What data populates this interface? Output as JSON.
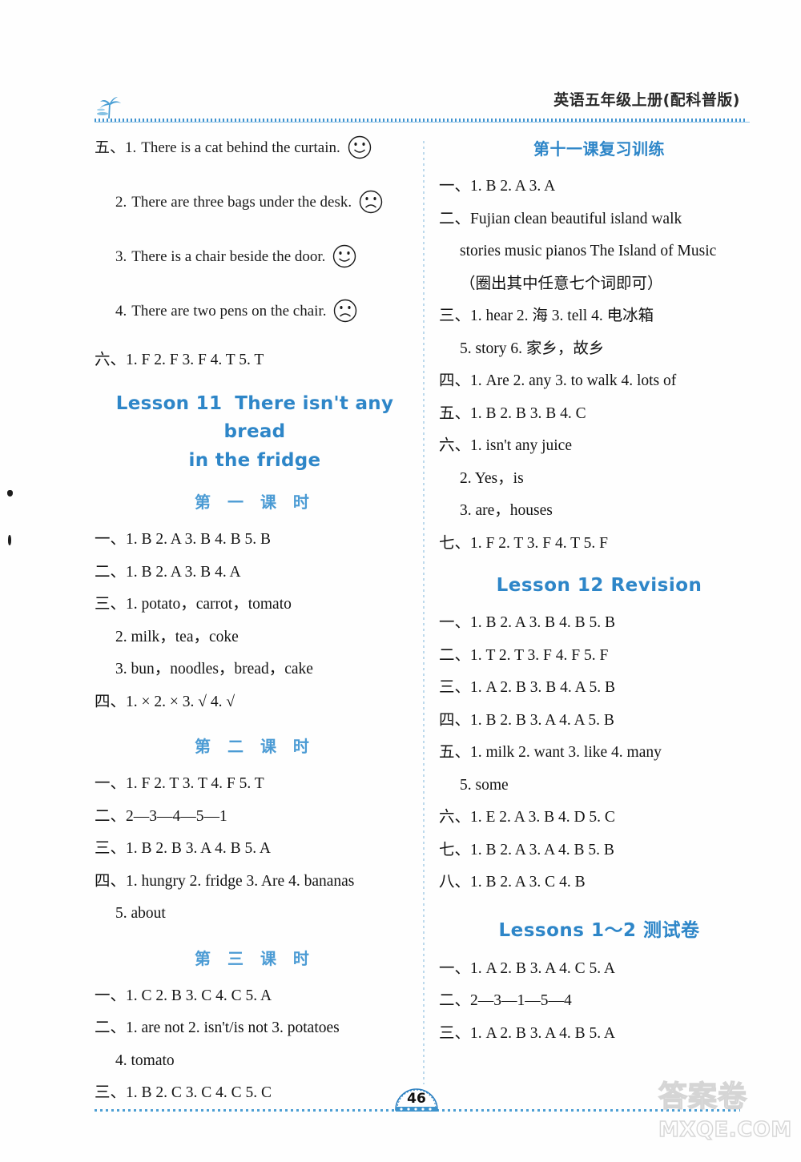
{
  "header": {
    "title": "英语五年级上册(配科普版)",
    "palm_icon": "palm-tree-icon"
  },
  "footer": {
    "page_number": "46",
    "watermark_cn": "答案卷",
    "watermark_url": "MXQE.COM"
  },
  "left_column": {
    "section_five_sentences": [
      {
        "num": "五、1.",
        "text": "There is a cat behind the curtain.",
        "face": "smile"
      },
      {
        "num": "2.",
        "text": "There are three bags under the desk.",
        "face": "frown"
      },
      {
        "num": "3.",
        "text": "There is a chair beside the door.",
        "face": "smile"
      },
      {
        "num": "4.",
        "text": "There are two pens on the chair.",
        "face": "frown"
      }
    ],
    "section_six": "六、1. F  2. F  3. F  4. T  5. T",
    "lesson11": {
      "label": "Lesson 11",
      "title_line1": "There isn't any bread",
      "title_line2": "in the fridge"
    },
    "period1": {
      "heading": "第 一 课 时",
      "lines": [
        "一、1. B  2. A  3. B  4. B  5. B",
        "二、1. B  2. A  3. B  4. A",
        "三、1. potato，carrot，tomato",
        "2. milk，tea，coke",
        "3. bun，noodles，bread，cake",
        "四、1. ×  2. ×  3. √  4. √"
      ]
    },
    "period2": {
      "heading": "第 二 课 时",
      "lines": [
        "一、1. F  2. T  3. T  4. F  5. T",
        "二、2—3—4—5—1",
        "三、1. B  2. B  3. A  4. B  5. A",
        "四、1. hungry  2. fridge  3. Are  4. bananas",
        "5. about"
      ]
    },
    "period3": {
      "heading": "第 三 课 时",
      "lines": [
        "一、1. C  2. B  3. C  4. C  5. A",
        "二、1. are not  2. isn't/is not  3. potatoes",
        "4. tomato",
        "三、1. B  2. C  3. C  4. C  5. C"
      ]
    }
  },
  "right_column": {
    "lesson11_review": {
      "heading": "第十一课复习训练",
      "lines": [
        "一、1. B  2. A  3. A",
        "二、Fujian   clean   beautiful   island   walk",
        "stories   music   pianos   The Island of Music",
        "（圈出其中任意七个词即可）",
        "三、1. hear  2. 海  3. tell  4. 电冰箱",
        "5. story   6. 家乡，故乡",
        "四、1. Are  2. any  3. to walk  4. lots of",
        "五、1. B  2. B  3. B  4. C",
        "六、1. isn't any juice",
        "2. Yes，is",
        "3. are，houses",
        "七、1. F  2. T  3. F  4. T  5. F"
      ]
    },
    "lesson12": {
      "heading": "Lesson 12    Revision",
      "lines": [
        "一、1. B  2. A  3. B  4. B  5. B",
        "二、1. T  2. T  3. F  4. F  5. F",
        "三、1. A  2. B  3. B  4. A  5. B",
        "四、1. B  2. B  3. A  4. A  5. B",
        "五、1. milk  2. want  3. like  4. many",
        "5. some",
        "六、1. E  2. A  3. B  4. D  5. C",
        "七、1. B  2. A  3. A  4. B  5. B",
        "八、1. B  2. A  3. C  4. B"
      ]
    },
    "lessons12_test": {
      "heading": "Lessons 1～2 测试卷",
      "lines": [
        "一、1. A  2. B  3. A  4. C  5. A",
        "二、2—3—1—5—4",
        "三、1. A  2. B  3. A  4. B  5. A"
      ]
    }
  },
  "colors": {
    "heading_blue": "#2e86c8",
    "period_blue": "#4b9bd4",
    "rule_blue": "#3f93d0",
    "divider_blue": "#bcd9ec"
  }
}
